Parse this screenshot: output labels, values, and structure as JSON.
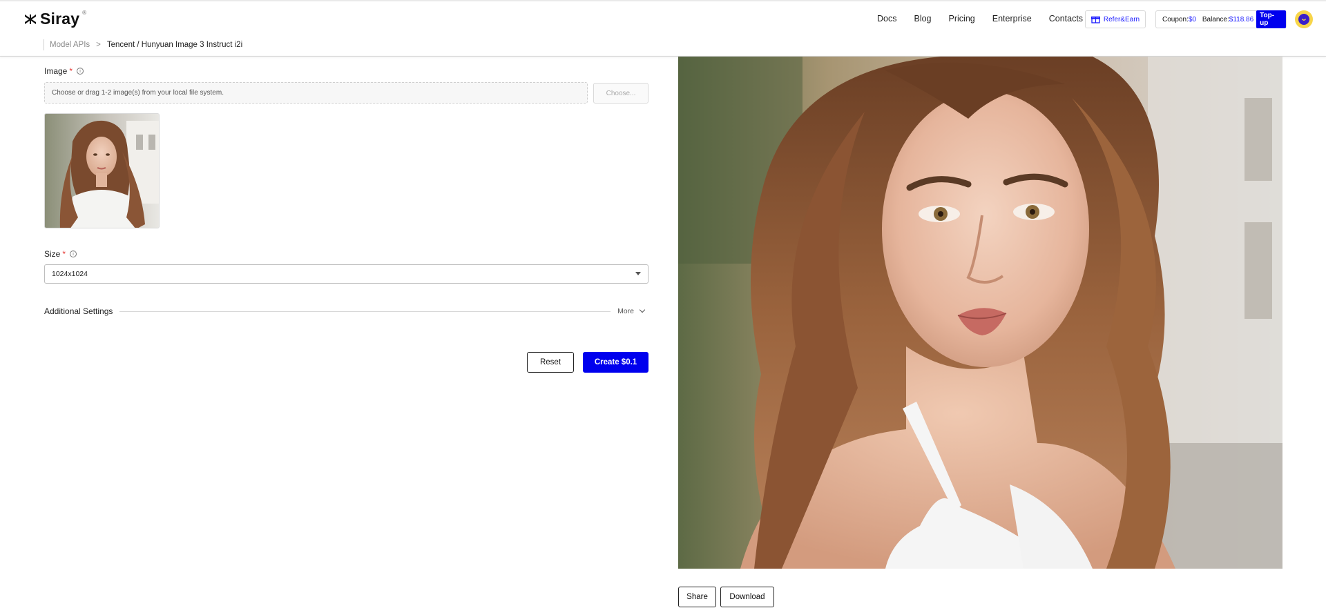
{
  "brand": {
    "name": "Siray",
    "reg_mark": "®"
  },
  "nav": {
    "items": [
      {
        "label": "Docs"
      },
      {
        "label": "Blog"
      },
      {
        "label": "Pricing"
      },
      {
        "label": "Enterprise"
      },
      {
        "label": "Contacts"
      }
    ],
    "refer_label": "Refer&Earn"
  },
  "wallet": {
    "coupon_label": "Coupon:",
    "coupon_value": "$0",
    "balance_label": "Balance:",
    "balance_value": "$118.86",
    "topup_label": "Top-up"
  },
  "breadcrumb": {
    "root": "Model APIs",
    "separator": ">",
    "current": "Tencent / Hunyuan Image 3 Instruct i2i"
  },
  "form": {
    "image": {
      "label": "Image",
      "required_mark": "*",
      "dropzone_placeholder": "Choose or drag 1-2 image(s) from your local file system.",
      "choose_label": "Choose..."
    },
    "size": {
      "label": "Size",
      "required_mark": "*",
      "selected": "1024x1024"
    },
    "additional_settings": {
      "title": "Additional Settings",
      "more_label": "More"
    },
    "reset_label": "Reset",
    "create_label": "Create $0.1"
  },
  "output": {
    "share_label": "Share",
    "download_label": "Download"
  },
  "colors": {
    "accent": "#0000ee",
    "link": "#1a1aff",
    "required": "#e53935",
    "avatar_bg": "#f7d54a"
  }
}
